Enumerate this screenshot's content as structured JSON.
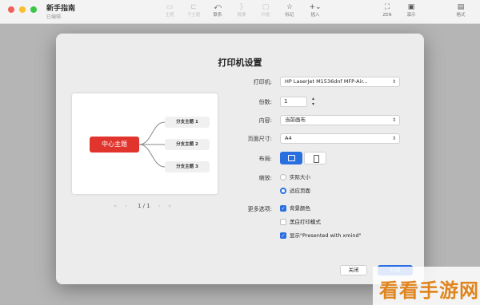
{
  "window": {
    "title": "新手指南",
    "subtitle": "已编辑"
  },
  "toolbar": {
    "items": [
      {
        "label": "主题",
        "icon": "topic-icon",
        "enabled": false
      },
      {
        "label": "子主题",
        "icon": "subtopic-icon",
        "enabled": false
      },
      {
        "label": "联系",
        "icon": "relationship-icon",
        "enabled": true
      },
      {
        "label": "概要",
        "icon": "summary-icon",
        "enabled": false
      },
      {
        "label": "外框",
        "icon": "boundary-icon",
        "enabled": false
      },
      {
        "label": "标记",
        "icon": "star-icon",
        "enabled": true
      },
      {
        "label": "插入",
        "icon": "insert-icon",
        "enabled": true
      },
      {
        "label": "ZEN",
        "icon": "zen-icon",
        "enabled": true
      },
      {
        "label": "演示",
        "icon": "presentation-icon",
        "enabled": true
      },
      {
        "label": "格式",
        "icon": "format-icon",
        "enabled": true
      }
    ]
  },
  "dialog": {
    "title": "打印机设置",
    "preview": {
      "central_topic": "中心主题",
      "branches": [
        "分支主题 1",
        "分支主题 2",
        "分支主题 3"
      ],
      "page_indicator": "1 / 1"
    },
    "fields": {
      "printer_label": "打印机:",
      "printer_value": "HP LaserJet M1536dnf MFP-Air...",
      "copies_label": "份数:",
      "copies_value": "1",
      "content_label": "内容:",
      "content_value": "当前画布",
      "paper_label": "页面尺寸:",
      "paper_value": "A4",
      "layout_label": "布局:",
      "layout_selected": "landscape",
      "scale_label": "缩放:",
      "scale_options": [
        {
          "label": "实际大小",
          "selected": false
        },
        {
          "label": "适应页面",
          "selected": true
        }
      ],
      "more_label": "更多选项:",
      "more_options": [
        {
          "label": "背景颜色",
          "checked": true
        },
        {
          "label": "黑白打印模式",
          "checked": false
        },
        {
          "label": "显示\"Presented with xmind\"",
          "checked": true
        }
      ]
    },
    "buttons": {
      "close": "关闭",
      "print": "打印"
    }
  },
  "watermark": {
    "text": "看看手游网"
  },
  "colors": {
    "accent": "#2a6fe0",
    "central_topic": "#e0342c",
    "watermark": "#e0851e"
  }
}
